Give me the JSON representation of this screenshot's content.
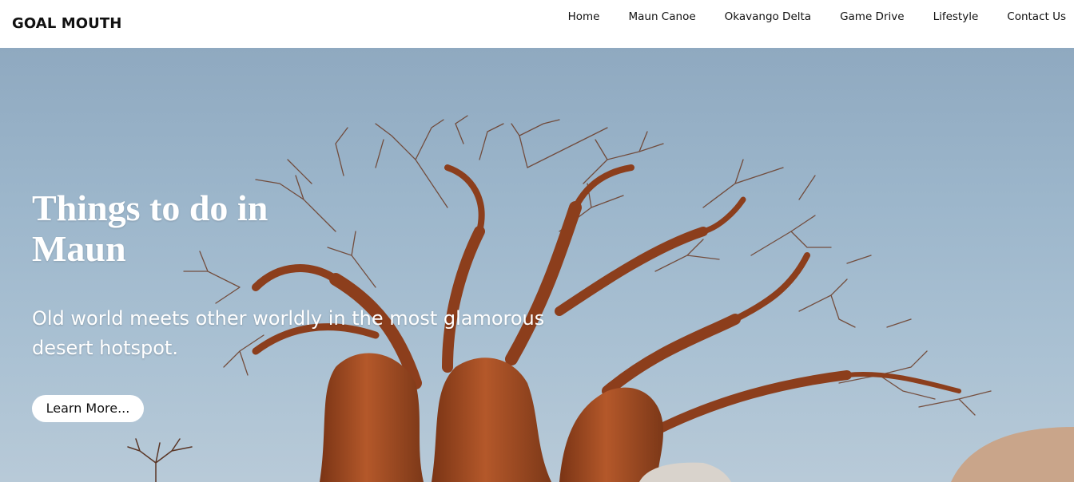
{
  "header": {
    "brand": "GOAL MOUTH",
    "nav": [
      {
        "label": "Home"
      },
      {
        "label": "Maun Canoe"
      },
      {
        "label": "Okavango Delta"
      },
      {
        "label": "Game Drive"
      },
      {
        "label": "Lifestyle"
      },
      {
        "label": "Contact Us"
      }
    ]
  },
  "hero": {
    "title": "Things to do in Maun",
    "subtitle": "Old world meets other worldly in the most glamorous desert hotspot.",
    "button_label": "Learn More...",
    "background_image": "baobab-tree-photo"
  },
  "colors": {
    "sky": "#9cb6cb",
    "trunk": "#9a4a22",
    "hero_text": "#ffffff",
    "button_bg": "#ffffff"
  }
}
